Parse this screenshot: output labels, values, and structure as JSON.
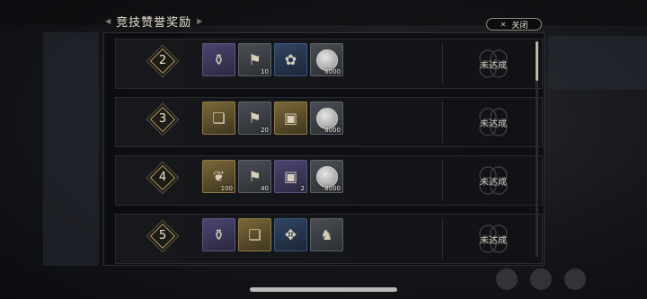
{
  "header": {
    "title": "竞技赞誉奖励"
  },
  "close_button": {
    "label": "关闭"
  },
  "rows": [
    {
      "rank": "2",
      "items": [
        {
          "icon": "lantern-icon",
          "rarity": "purple",
          "qty": ""
        },
        {
          "icon": "flag-icon",
          "rarity": "gray",
          "qty": "10"
        },
        {
          "icon": "flowers-icon",
          "rarity": "blue",
          "qty": ""
        },
        {
          "icon": "silver-coin-icon",
          "rarity": "gray",
          "qty": "6000"
        }
      ],
      "status": "未达成"
    },
    {
      "rank": "3",
      "items": [
        {
          "icon": "book-icon",
          "rarity": "gold",
          "qty": ""
        },
        {
          "icon": "flag-icon",
          "rarity": "gray",
          "qty": "20"
        },
        {
          "icon": "chest-icon",
          "rarity": "gold",
          "qty": ""
        },
        {
          "icon": "silver-coin-icon",
          "rarity": "gray",
          "qty": "8000"
        }
      ],
      "status": "未达成"
    },
    {
      "rank": "4",
      "items": [
        {
          "icon": "feather-icon",
          "rarity": "gold",
          "qty": "100"
        },
        {
          "icon": "flag-icon",
          "rarity": "gray",
          "qty": "40"
        },
        {
          "icon": "chest-icon",
          "rarity": "purple",
          "qty": "2"
        },
        {
          "icon": "silver-coin-icon",
          "rarity": "gray",
          "qty": "8000"
        }
      ],
      "status": "未达成"
    },
    {
      "rank": "5",
      "items": [
        {
          "icon": "lantern-icon",
          "rarity": "purple",
          "qty": ""
        },
        {
          "icon": "book-icon",
          "rarity": "gold",
          "qty": ""
        },
        {
          "icon": "ornament-icon",
          "rarity": "blue",
          "qty": ""
        },
        {
          "icon": "figure-icon",
          "rarity": "gray",
          "qty": ""
        }
      ],
      "status": "未达成"
    }
  ]
}
